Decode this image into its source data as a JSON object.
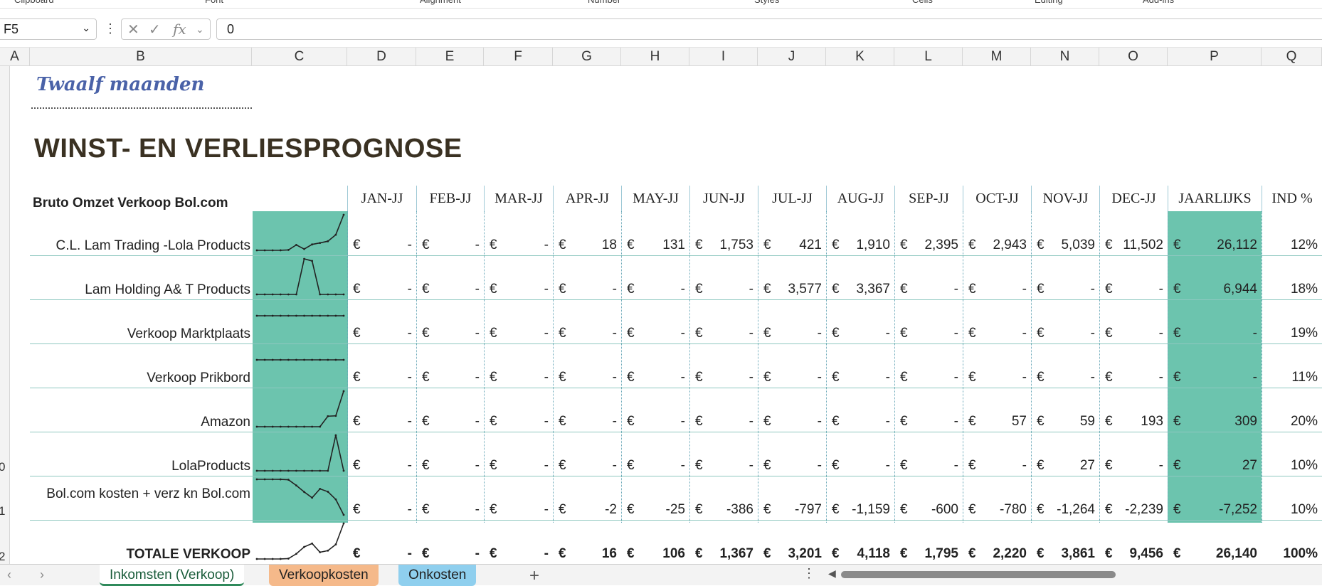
{
  "ribbon": [
    "Clipboard",
    "Font",
    "Alignment",
    "Number",
    "Styles",
    "Cells",
    "Editing",
    "Add-ins"
  ],
  "formula_bar": {
    "name_box": "F5",
    "value": "0",
    "fx": "fx"
  },
  "columns": [
    "A",
    "B",
    "C",
    "D",
    "E",
    "F",
    "G",
    "H",
    "I",
    "J",
    "K",
    "L",
    "M",
    "N",
    "O",
    "P",
    "Q"
  ],
  "row_numbers": [
    "0",
    "1",
    "2"
  ],
  "sheet": {
    "subtitle": "Twaalf maanden",
    "title": "WINST- EN VERLIESPROGNOSE",
    "section_label": "Bruto Omzet Verkoop Bol.com",
    "month_headers": [
      "JAN-JJ",
      "FEB-JJ",
      "MAR-JJ",
      "APR-JJ",
      "MAY-JJ",
      "JUN-JJ",
      "JUL-JJ",
      "AUG-JJ",
      "SEP-JJ",
      "OCT-JJ",
      "NOV-JJ",
      "DEC-JJ",
      "JAARLIJKS",
      "IND %"
    ],
    "currency": "€",
    "rows": [
      {
        "label": "C.L. Lam Trading -Lola Products",
        "values": [
          "-",
          "-",
          "-",
          "18",
          "131",
          "1,753",
          "421",
          "1,910",
          "2,395",
          "2,943",
          "5,039",
          "11,502",
          "26,112"
        ],
        "pct": "12%",
        "spark": [
          0,
          0,
          0,
          18,
          131,
          1753,
          421,
          1910,
          2395,
          2943,
          5039,
          11502
        ]
      },
      {
        "label": "Lam Holding A& T Products",
        "values": [
          "-",
          "-",
          "-",
          "-",
          "-",
          "-",
          "3,577",
          "3,367",
          "-",
          "-",
          "-",
          "-",
          "6,944"
        ],
        "pct": "18%",
        "spark": [
          0,
          0,
          0,
          0,
          0,
          0,
          3577,
          3367,
          0,
          0,
          0,
          0
        ]
      },
      {
        "label": "Verkoop Marktplaats",
        "values": [
          "-",
          "-",
          "-",
          "-",
          "-",
          "-",
          "-",
          "-",
          "-",
          "-",
          "-",
          "-",
          "-"
        ],
        "pct": "19%",
        "spark": [
          0,
          0,
          0,
          0,
          0,
          0,
          0,
          0,
          0,
          0,
          0,
          0
        ]
      },
      {
        "label": "Verkoop Prikbord",
        "values": [
          "-",
          "-",
          "-",
          "-",
          "-",
          "-",
          "-",
          "-",
          "-",
          "-",
          "-",
          "-",
          "-"
        ],
        "pct": "11%",
        "spark": [
          0,
          0,
          0,
          0,
          0,
          0,
          0,
          0,
          0,
          0,
          0,
          0
        ]
      },
      {
        "label": "Amazon",
        "values": [
          "-",
          "-",
          "-",
          "-",
          "-",
          "-",
          "-",
          "-",
          "-",
          "57",
          "59",
          "193",
          "309"
        ],
        "pct": "20%",
        "spark": [
          0,
          0,
          0,
          0,
          0,
          0,
          0,
          0,
          0,
          57,
          59,
          193
        ]
      },
      {
        "label": "LolaProducts",
        "values": [
          "-",
          "-",
          "-",
          "-",
          "-",
          "-",
          "-",
          "-",
          "-",
          "-",
          "27",
          "-",
          "27"
        ],
        "pct": "10%",
        "spark": [
          0,
          0,
          0,
          0,
          0,
          0,
          0,
          0,
          0,
          0,
          27,
          0
        ]
      },
      {
        "label": "Bol.com kosten + verz kn Bol.com",
        "values": [
          "-",
          "-",
          "-",
          "-2",
          "-25",
          "-386",
          "-797",
          "-1,159",
          "-600",
          "-780",
          "-1,264",
          "-2,239",
          "-7,252"
        ],
        "pct": "10%",
        "spark": [
          0,
          0,
          0,
          -2,
          -25,
          -386,
          -797,
          -1159,
          -600,
          -780,
          -1264,
          -2239
        ]
      },
      {
        "label": "TOTALE VERKOOP",
        "values": [
          "-",
          "-",
          "-",
          "16",
          "106",
          "1,367",
          "3,201",
          "4,118",
          "1,795",
          "2,220",
          "3,861",
          "9,456",
          "26,140"
        ],
        "pct": "100%",
        "spark": [
          0,
          0,
          0,
          16,
          106,
          1367,
          3201,
          4118,
          1795,
          2220,
          3861,
          9456
        ],
        "bold": true
      }
    ]
  },
  "tabs": {
    "sheets": [
      "Inkomsten (Verkoop)",
      "Verkoopkosten",
      "Onkosten"
    ],
    "active": "Inkomsten (Verkoop)",
    "colors": {
      "active": "#ffffff",
      "orange": "#f5b98a",
      "blue": "#8fcfee"
    }
  },
  "colors": {
    "accent_teal": "#6cc4ae",
    "title_blue": "#4a62a8"
  }
}
